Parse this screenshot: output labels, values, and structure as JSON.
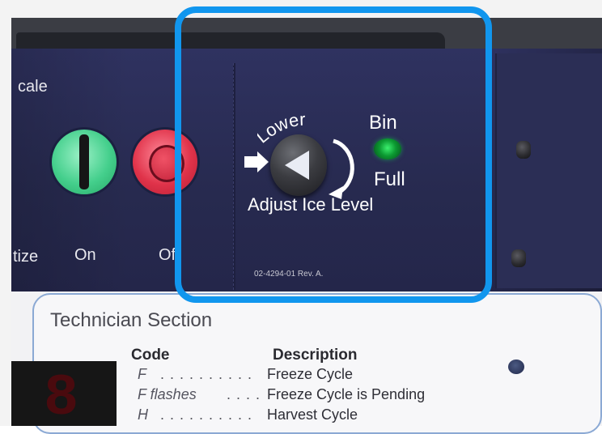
{
  "control_panel": {
    "partial_scale_label": "cale",
    "partial_sanitize_label": "tize",
    "on_label": "On",
    "partial_off_label": "Of",
    "ice_adjust": {
      "lower_label": "Lower",
      "adjust_label": "Adjust Ice Level"
    },
    "bin_full": {
      "bin_label": "Bin",
      "full_label": "Full"
    },
    "part_number": "02-4294-01 Rev. A."
  },
  "technician_section": {
    "title": "Technician Section",
    "display_digit": "8",
    "headers": {
      "code": "Code",
      "description": "Description"
    },
    "rows": [
      {
        "code": "F",
        "leader": ". . . . . . . . . .",
        "description": "Freeze Cycle"
      },
      {
        "code": "F  flashes",
        "leader": ". . . .",
        "description": "Freeze Cycle is Pending"
      },
      {
        "code": "H",
        "leader": ". . . . . . . . . .",
        "description": "Harvest Cycle"
      }
    ]
  },
  "colors": {
    "highlight_border": "#1196ee",
    "panel": "#2a2d52",
    "on_button": "#44cf8c",
    "off_button": "#e0334a",
    "bin_full_led": "#1ec24c"
  },
  "icons": [
    "lower-direction-pointer-icon",
    "counterclockwise-arrow-icon",
    "knob-triangle-icon"
  ]
}
